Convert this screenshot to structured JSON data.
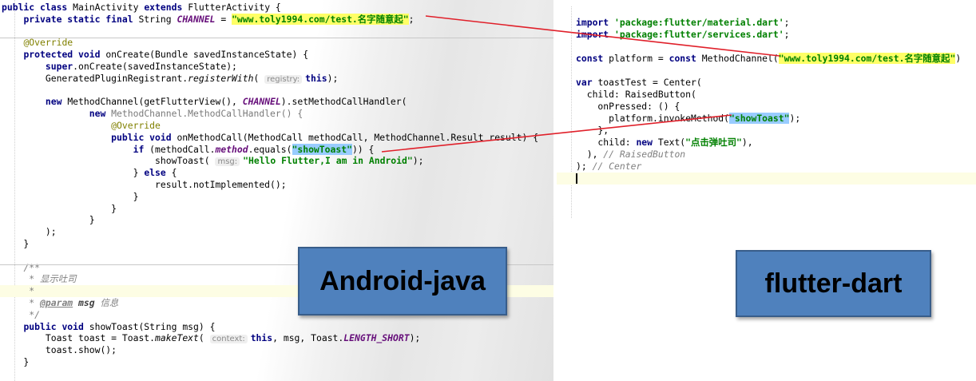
{
  "java": {
    "lines": [
      {
        "parts": [
          {
            "c": "kw",
            "t": "public class "
          },
          {
            "c": "",
            "t": "MainActivity "
          },
          {
            "c": "kw",
            "t": "extends "
          },
          {
            "c": "",
            "t": "FlutterActivity {"
          }
        ]
      },
      {
        "parts": [
          {
            "c": "",
            "t": "    "
          },
          {
            "c": "kw",
            "t": "private static final "
          },
          {
            "c": "",
            "t": "String "
          },
          {
            "c": "const",
            "t": "CHANNEL"
          },
          {
            "c": "",
            "t": " = "
          },
          {
            "c": "strhl",
            "t": "\"www.toly1994.com/test.名字随意起\""
          },
          {
            "c": "",
            "t": ";"
          }
        ]
      },
      {
        "parts": []
      },
      {
        "parts": [
          {
            "c": "",
            "t": "    "
          },
          {
            "c": "ann",
            "t": "@Override"
          }
        ]
      },
      {
        "parts": [
          {
            "c": "",
            "t": "    "
          },
          {
            "c": "kw",
            "t": "protected void "
          },
          {
            "c": "",
            "t": "onCreate(Bundle savedInstanceState) {"
          }
        ]
      },
      {
        "parts": [
          {
            "c": "",
            "t": "        "
          },
          {
            "c": "kw",
            "t": "super"
          },
          {
            "c": "",
            "t": ".onCreate(savedInstanceState);"
          }
        ]
      },
      {
        "parts": [
          {
            "c": "",
            "t": "        GeneratedPluginRegistrant."
          },
          {
            "c": "ital",
            "t": "registerWith"
          },
          {
            "c": "",
            "t": "( "
          },
          {
            "c": "hint",
            "t": "registry:"
          },
          {
            "c": "kw",
            "t": "this"
          },
          {
            "c": "",
            "t": ");"
          }
        ]
      },
      {
        "parts": []
      },
      {
        "parts": [
          {
            "c": "",
            "t": "        "
          },
          {
            "c": "kw",
            "t": "new "
          },
          {
            "c": "",
            "t": "MethodChannel(getFlutterView(), "
          },
          {
            "c": "const",
            "t": "CHANNEL"
          },
          {
            "c": "",
            "t": ").setMethodCallHandler("
          }
        ]
      },
      {
        "parts": [
          {
            "c": "",
            "t": "                "
          },
          {
            "c": "kw",
            "t": "new "
          },
          {
            "c": "gray",
            "t": "MethodChannel.MethodCallHandler() {"
          }
        ]
      },
      {
        "parts": [
          {
            "c": "",
            "t": "                    "
          },
          {
            "c": "ann",
            "t": "@Override"
          }
        ]
      },
      {
        "parts": [
          {
            "c": "",
            "t": "                    "
          },
          {
            "c": "kw",
            "t": "public void "
          },
          {
            "c": "",
            "t": "onMethodCall(MethodCall methodCall, MethodChannel.Result result) {"
          }
        ]
      },
      {
        "parts": [
          {
            "c": "",
            "t": "                        "
          },
          {
            "c": "kw",
            "t": "if "
          },
          {
            "c": "",
            "t": "(methodCall."
          },
          {
            "c": "const",
            "t": "method"
          },
          {
            "c": "",
            "t": ".equals("
          },
          {
            "c": "strblue",
            "t": "\"showToast\""
          },
          {
            "c": "",
            "t": ")) {"
          }
        ]
      },
      {
        "parts": [
          {
            "c": "",
            "t": "                            showToast( "
          },
          {
            "c": "hint",
            "t": "msg:"
          },
          {
            "c": "str",
            "t": "\"Hello Flutter,I am in Android\""
          },
          {
            "c": "",
            "t": ");"
          }
        ]
      },
      {
        "parts": [
          {
            "c": "",
            "t": "                        } "
          },
          {
            "c": "kw",
            "t": "else "
          },
          {
            "c": "",
            "t": "{"
          }
        ]
      },
      {
        "parts": [
          {
            "c": "",
            "t": "                            result.notImplemented();"
          }
        ]
      },
      {
        "parts": [
          {
            "c": "",
            "t": "                        }"
          }
        ]
      },
      {
        "parts": [
          {
            "c": "",
            "t": "                    }"
          }
        ]
      },
      {
        "parts": [
          {
            "c": "",
            "t": "                }"
          }
        ]
      },
      {
        "parts": [
          {
            "c": "",
            "t": "        );"
          }
        ]
      },
      {
        "parts": [
          {
            "c": "",
            "t": "    }"
          }
        ]
      },
      {
        "parts": []
      },
      {
        "parts": [
          {
            "c": "",
            "t": "    "
          },
          {
            "c": "cmt",
            "t": "/**"
          }
        ]
      },
      {
        "parts": [
          {
            "c": "",
            "t": "     "
          },
          {
            "c": "cmt",
            "t": "* 显示吐司"
          }
        ]
      },
      {
        "parts": [
          {
            "c": "",
            "t": "     "
          },
          {
            "c": "cmt",
            "t": "*"
          }
        ]
      },
      {
        "parts": [
          {
            "c": "",
            "t": "     "
          },
          {
            "c": "cmt",
            "t": "* "
          },
          {
            "c": "tag",
            "t": "@param"
          },
          {
            "c": "",
            "t": " "
          },
          {
            "c": "tagparam",
            "t": "msg"
          },
          {
            "c": "cmt",
            "t": " 信息"
          }
        ]
      },
      {
        "parts": [
          {
            "c": "",
            "t": "     "
          },
          {
            "c": "cmt",
            "t": "*/"
          }
        ]
      },
      {
        "parts": [
          {
            "c": "",
            "t": "    "
          },
          {
            "c": "kw",
            "t": "public void "
          },
          {
            "c": "",
            "t": "showToast(String msg) {"
          }
        ]
      },
      {
        "parts": [
          {
            "c": "",
            "t": "        Toast toast = Toast."
          },
          {
            "c": "ital",
            "t": "makeText"
          },
          {
            "c": "",
            "t": "( "
          },
          {
            "c": "hint",
            "t": "context:"
          },
          {
            "c": "kw",
            "t": "this"
          },
          {
            "c": "",
            "t": ", msg, Toast."
          },
          {
            "c": "const",
            "t": "LENGTH_SHORT"
          },
          {
            "c": "",
            "t": ");"
          }
        ]
      },
      {
        "parts": [
          {
            "c": "",
            "t": "        toast.show();"
          }
        ]
      },
      {
        "parts": [
          {
            "c": "",
            "t": "    }"
          }
        ]
      }
    ]
  },
  "dart": {
    "lines": [
      {
        "parts": [
          {
            "c": "kw",
            "t": "import "
          },
          {
            "c": "str",
            "t": "'package:flutter/material.dart'"
          },
          {
            "c": "",
            "t": ";"
          }
        ]
      },
      {
        "parts": [
          {
            "c": "kw",
            "t": "import "
          },
          {
            "c": "str",
            "t": "'package:flutter/services.dart'"
          },
          {
            "c": "",
            "t": ";"
          }
        ]
      },
      {
        "parts": []
      },
      {
        "parts": [
          {
            "c": "kw",
            "t": "const "
          },
          {
            "c": "",
            "t": "platform = "
          },
          {
            "c": "kw",
            "t": "const "
          },
          {
            "c": "",
            "t": "MethodChannel("
          },
          {
            "c": "strhl",
            "t": "\"www.toly1994.com/test.名字随意起\""
          },
          {
            "c": "",
            "t": ")"
          }
        ]
      },
      {
        "parts": []
      },
      {
        "parts": [
          {
            "c": "kw",
            "t": "var "
          },
          {
            "c": "",
            "t": "toastTest = Center("
          }
        ]
      },
      {
        "parts": [
          {
            "c": "",
            "t": "  child: RaisedButton("
          }
        ]
      },
      {
        "parts": [
          {
            "c": "",
            "t": "    onPressed: () {"
          }
        ]
      },
      {
        "parts": [
          {
            "c": "",
            "t": "      platform.invokeMethod("
          },
          {
            "c": "strblue",
            "t": "\"showToast\""
          },
          {
            "c": "",
            "t": ");"
          }
        ]
      },
      {
        "parts": [
          {
            "c": "",
            "t": "    },"
          }
        ]
      },
      {
        "parts": [
          {
            "c": "",
            "t": "    child: "
          },
          {
            "c": "kw",
            "t": "new "
          },
          {
            "c": "",
            "t": "Text("
          },
          {
            "c": "str",
            "t": "\"点击弹吐司\""
          },
          {
            "c": "",
            "t": "),"
          }
        ]
      },
      {
        "parts": [
          {
            "c": "",
            "t": "  ), "
          },
          {
            "c": "cmt",
            "t": "// RaisedButton"
          }
        ]
      },
      {
        "parts": [
          {
            "c": "",
            "t": "); "
          },
          {
            "c": "cmt",
            "t": "// Center"
          }
        ]
      },
      {
        "parts": []
      }
    ]
  },
  "labels": {
    "android": "Android-java",
    "flutter": "flutter-dart"
  },
  "colors": {
    "label_fill": "#4f81bd",
    "connector": "#e0202a",
    "string_highlight": "#ffff66",
    "method_highlight": "#99ccff"
  }
}
